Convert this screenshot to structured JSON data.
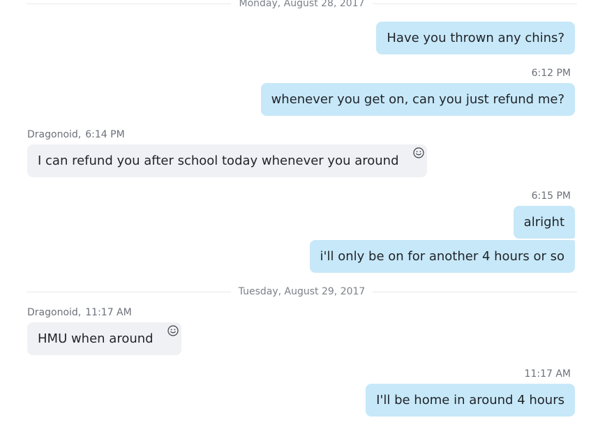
{
  "conversation": {
    "date_separators": [
      "Monday, August 28, 2017",
      "Tuesday, August 29, 2017"
    ],
    "messages": [
      {
        "direction": "out",
        "time": "",
        "text": "Have you thrown any chins?"
      },
      {
        "direction": "out",
        "time": "6:12 PM",
        "text": "whenever you get on, can you just refund me?"
      },
      {
        "direction": "in",
        "sender": "Dragonoid",
        "time": "6:14 PM",
        "text": "I can refund you after school today whenever you around"
      },
      {
        "direction": "out",
        "time": "6:15 PM",
        "text": "alright"
      },
      {
        "direction": "out",
        "time": "",
        "text": "i'll only be on for another 4 hours or so"
      },
      {
        "direction": "in",
        "sender": "Dragonoid",
        "time": "11:17 AM",
        "text": "HMU when around"
      },
      {
        "direction": "out",
        "time": "11:17 AM",
        "text": "I'll be home in around 4 hours"
      }
    ]
  },
  "icons": {
    "reaction": "smiley-reaction-icon"
  },
  "colors": {
    "outgoing_bubble": "#c7e8f8",
    "incoming_bubble": "#eff1f4",
    "meta_text": "#6b7079",
    "divider_line": "#e6e8ec"
  }
}
